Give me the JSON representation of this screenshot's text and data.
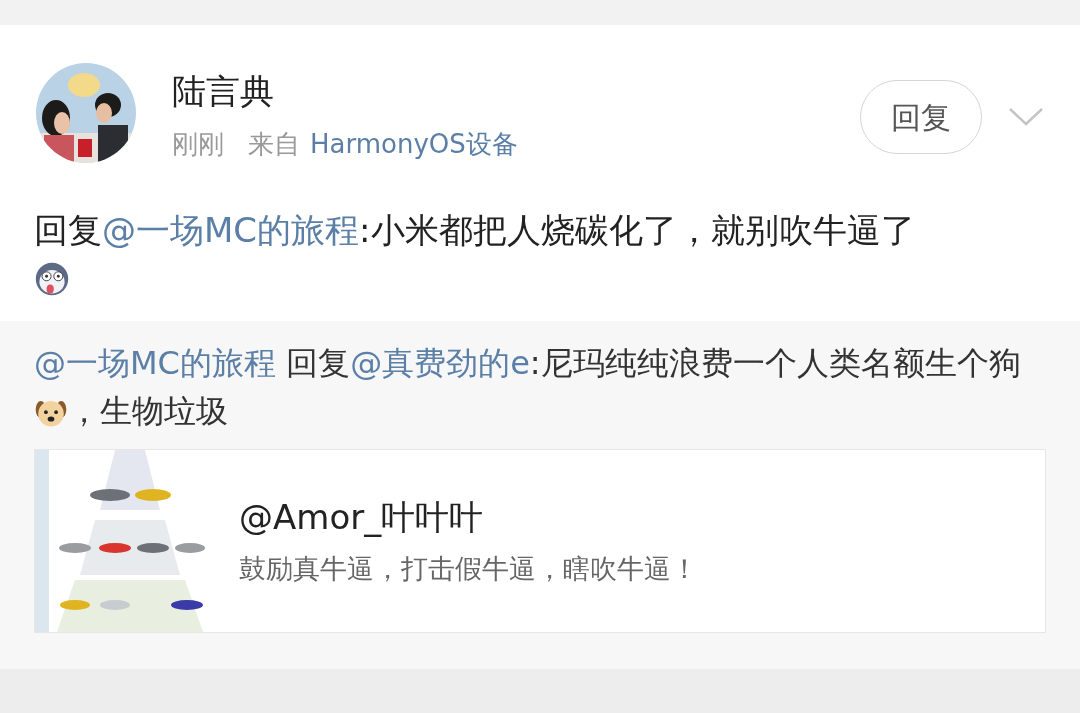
{
  "post": {
    "author": "陆言典",
    "time": "刚刚",
    "source_prefix": "来自",
    "source": "HarmonyOS设备",
    "reply_button": "回复",
    "content": {
      "prefix": "回复",
      "mention": "@一场MC的旅程",
      "text": ":小米都把人烧碳化了，就别吹牛逼了"
    }
  },
  "repost": {
    "author_mention": "@一场MC的旅程",
    "reply_word": "回复",
    "mention": "@真费劲的e",
    "text_before_emoji": ":尼玛纯纯浪费一个人类名额生个狗",
    "text_after_emoji": "，生物垃圾",
    "link_card": {
      "title": "@Amor_叶叶叶",
      "subtitle": "鼓励真牛逼，打击假牛逼，瞎吹牛逼！"
    }
  }
}
